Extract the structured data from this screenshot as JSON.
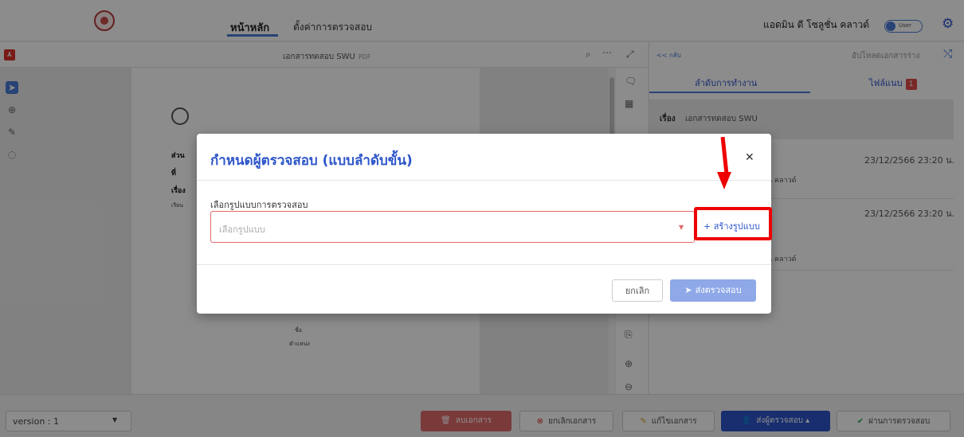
{
  "nav": {
    "home": "หน้าหลัก",
    "settings": "ตั้งค่าการตรวจสอบ",
    "user_name": "แอดมิน ดี โซลูชั่น คลาวด์",
    "toggle_label": "User"
  },
  "pdf": {
    "title": "เอกสารทดสอบ SWU",
    "ext": "PDF"
  },
  "document": {
    "line1": "ส่วน",
    "line2": "ที่",
    "line3": "เรื่อง",
    "line4": "เรียน",
    "sign_name": "ชื่อ",
    "sign_position": "ตำแหน่ง"
  },
  "right_panel": {
    "back": "<< กลับ",
    "upload_draft": "อัปโหลดเอกสารร่าง",
    "tab_workflow": "ลำดับการทำงาน",
    "tab_attachments": "ไฟล์แนบ",
    "attachment_count": "1",
    "subject_label": "เรื่อง",
    "subject_value": "เอกสารทดสอบ SWU",
    "timestamp1": "23/12/2566 23:20 น.",
    "timestamp2": "23/12/2566 23:20 น.",
    "name1": "น คลาวด์",
    "name2": "น คลาวด์"
  },
  "bottom": {
    "version": "version : 1",
    "delete": "ลบเอกสาร",
    "cancel_doc": "ยกเลิกเอกสาร",
    "edit_doc": "แก้ไขเอกสาร",
    "send_reviewer": "ส่งผู้ตรวจสอบ",
    "pass_review": "ผ่านการตรวจสอบ"
  },
  "modal": {
    "title": "กำหนดผู้ตรวจสอบ (แบบลำดับขั้น)",
    "select_label": "เลือกรูปแบบการตรวจสอบ",
    "select_placeholder": "เลือกรูปแบบ",
    "create_template": "+ สร้างรูปแบบ",
    "cancel": "ยกเลิก",
    "submit": "ส่งตรวจสอบ"
  },
  "colors": {
    "accent": "#2c55c9",
    "danger": "#e06a6a",
    "annotation": "#ee0000"
  }
}
